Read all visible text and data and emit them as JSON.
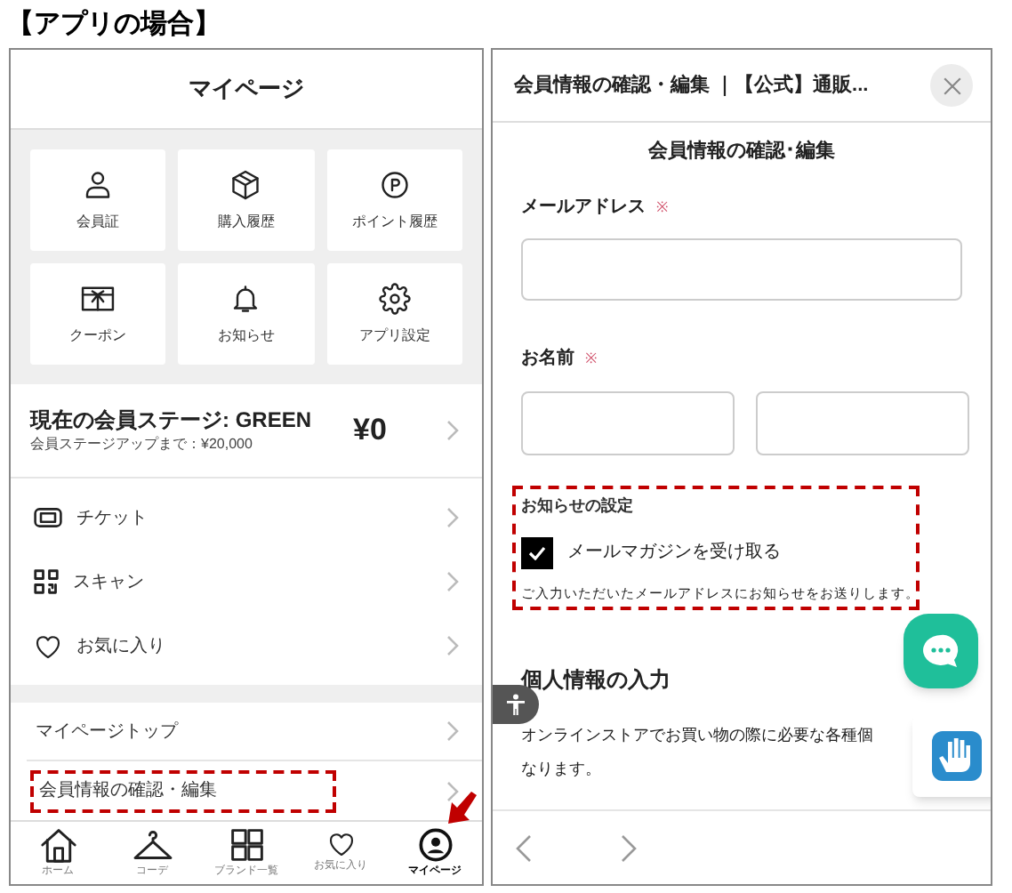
{
  "caption": "【アプリの場合】",
  "app": {
    "header": "マイページ",
    "tiles": [
      {
        "label": "会員証"
      },
      {
        "label": "購入履歴"
      },
      {
        "label": "ポイント履歴"
      },
      {
        "label": "クーポン"
      },
      {
        "label": "お知らせ"
      },
      {
        "label": "アプリ設定"
      }
    ],
    "stage": {
      "title": "現在の会員ステージ: GREEN",
      "subtitle": "会員ステージアップまで：¥20,000",
      "amount": "¥0"
    },
    "menu": [
      {
        "label": "チケット"
      },
      {
        "label": "スキャン"
      },
      {
        "label": "お気に入り"
      }
    ],
    "links": [
      {
        "label": "マイページトップ",
        "highlighted": false
      },
      {
        "label": "会員情報の確認・編集",
        "highlighted": true
      }
    ],
    "nav": [
      {
        "label": "ホーム",
        "selected": false
      },
      {
        "label": "コーデ",
        "selected": false
      },
      {
        "label": "ブランド一覧",
        "selected": false
      },
      {
        "label": "お気に入り",
        "selected": false
      },
      {
        "label": "マイページ",
        "selected": true
      }
    ]
  },
  "web": {
    "title": "会員情報の確認・編集 ｜【公式】通販...",
    "heading": "会員情報の確認･編集",
    "email_label": "メールアドレス",
    "email_required": "※",
    "name_label": "お名前",
    "name_required": "※",
    "notice": {
      "title": "お知らせの設定",
      "checkbox": {
        "label": "メールマガジンを受け取る",
        "checked": true
      },
      "note": "ご入力いただいたメールアドレスにお知らせをお送りします。"
    },
    "section_title": "個人情報の入力",
    "paragraph_lines": [
      "オンラインストアでお買い物の際に必要な各種個",
      "なります。"
    ]
  }
}
